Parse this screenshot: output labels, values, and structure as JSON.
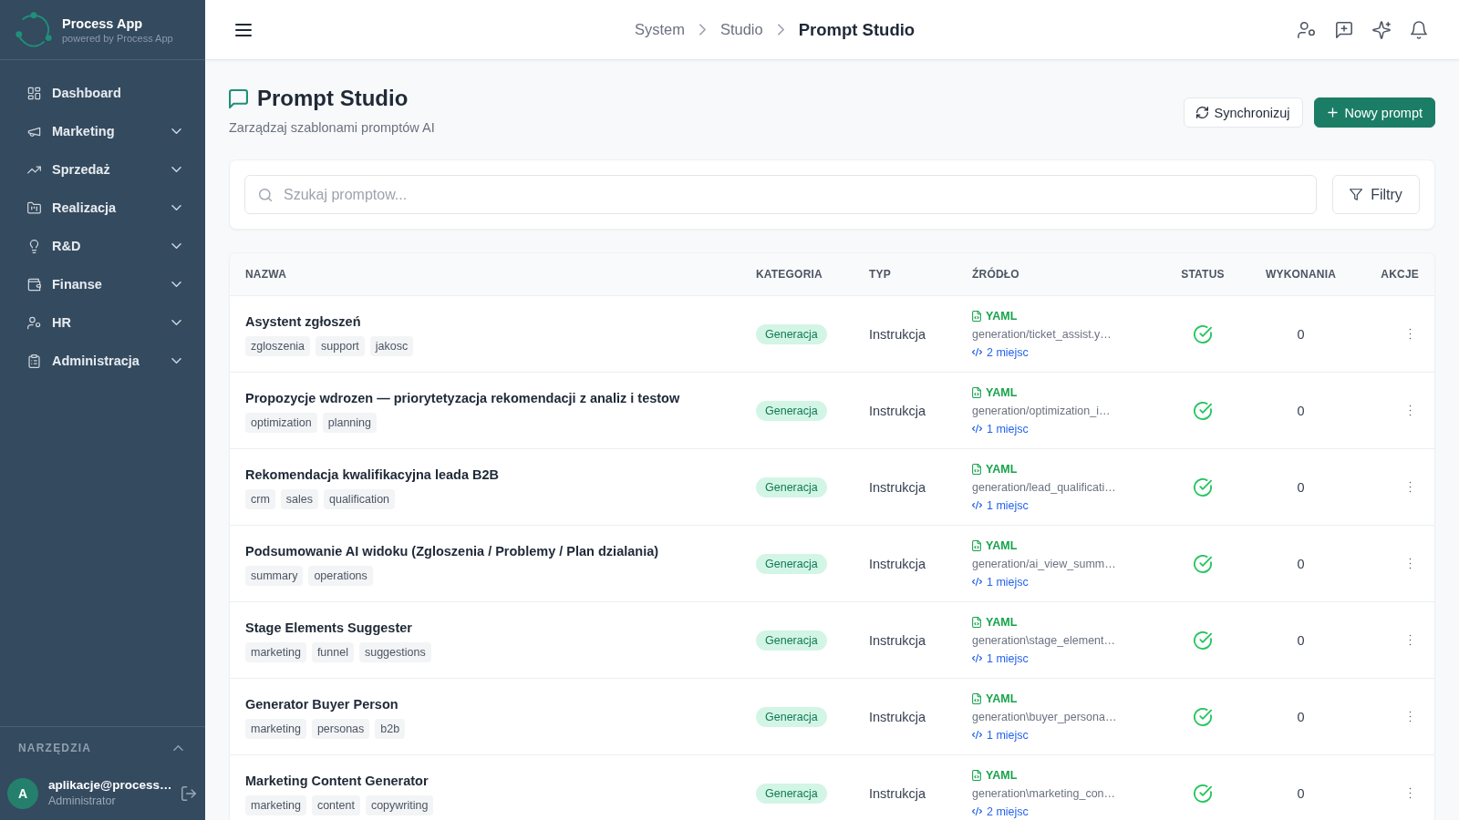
{
  "sidebar": {
    "brand": {
      "name": "Process App",
      "tagline": "powered by Process App"
    },
    "items": [
      {
        "label": "Dashboard",
        "kind": "link"
      },
      {
        "label": "Marketing",
        "kind": "group",
        "expanded": false
      },
      {
        "label": "Sprzedaż",
        "kind": "group",
        "expanded": false
      },
      {
        "label": "Realizacja",
        "kind": "group",
        "expanded": false
      },
      {
        "label": "R&D",
        "kind": "group",
        "expanded": false
      },
      {
        "label": "Finanse",
        "kind": "group",
        "expanded": false
      },
      {
        "label": "HR",
        "kind": "group",
        "expanded": false
      },
      {
        "label": "Administracja",
        "kind": "group",
        "expanded": false
      }
    ],
    "tools_section": {
      "label": "NARZĘDZIA",
      "expanded": true
    },
    "user": {
      "initial": "A",
      "email": "aplikacje@process…",
      "role": "Administrator"
    }
  },
  "header": {
    "breadcrumbs": [
      {
        "label": "System",
        "current": false
      },
      {
        "label": "Studio",
        "current": false
      },
      {
        "label": "Prompt Studio",
        "current": true
      }
    ]
  },
  "page": {
    "title": "Prompt Studio",
    "subtitle": "Zarządzaj szablonami promptów AI",
    "buttons": [
      {
        "label": "Synchronizuj",
        "kind": "secondary"
      },
      {
        "label": "Nowy prompt",
        "kind": "primary"
      }
    ]
  },
  "search": {
    "placeholder": "Szukaj promptow...",
    "filter_button": "Filtry"
  },
  "table": {
    "columns": [
      "NAZWA",
      "KATEGORIA",
      "TYP",
      "ŹRÓDŁO",
      "STATUS",
      "WYKONANIA",
      "AKCJE"
    ],
    "rows": [
      {
        "name": "Asystent zgłoszeń",
        "tags": [
          "zgloszenia",
          "support",
          "jakosc"
        ],
        "category": "Generacja",
        "type": "Instrukcja",
        "source_format": "YAML",
        "source_path": "generation/ticket_assist.y…",
        "usages": "2 miejsc",
        "active": true,
        "runs": "0"
      },
      {
        "name": "Propozycje wdrozen — priorytetyzacja rekomendacji z analiz i testow",
        "tags": [
          "optimization",
          "planning"
        ],
        "category": "Generacja",
        "type": "Instrukcja",
        "source_format": "YAML",
        "source_path": "generation/optimization_i…",
        "usages": "1 miejsc",
        "active": true,
        "runs": "0"
      },
      {
        "name": "Rekomendacja kwalifikacyjna leada B2B",
        "tags": [
          "crm",
          "sales",
          "qualification"
        ],
        "category": "Generacja",
        "type": "Instrukcja",
        "source_format": "YAML",
        "source_path": "generation/lead_qualificati…",
        "usages": "1 miejsc",
        "active": true,
        "runs": "0"
      },
      {
        "name": "Podsumowanie AI widoku (Zgloszenia / Problemy / Plan dzialania)",
        "tags": [
          "summary",
          "operations"
        ],
        "category": "Generacja",
        "type": "Instrukcja",
        "source_format": "YAML",
        "source_path": "generation/ai_view_summ…",
        "usages": "1 miejsc",
        "active": true,
        "runs": "0"
      },
      {
        "name": "Stage Elements Suggester",
        "tags": [
          "marketing",
          "funnel",
          "suggestions"
        ],
        "category": "Generacja",
        "type": "Instrukcja",
        "source_format": "YAML",
        "source_path": "generation\\stage_element…",
        "usages": "1 miejsc",
        "active": true,
        "runs": "0"
      },
      {
        "name": "Generator Buyer Person",
        "tags": [
          "marketing",
          "personas",
          "b2b"
        ],
        "category": "Generacja",
        "type": "Instrukcja",
        "source_format": "YAML",
        "source_path": "generation\\buyer_persona…",
        "usages": "1 miejsc",
        "active": true,
        "runs": "0"
      },
      {
        "name": "Marketing Content Generator",
        "tags": [
          "marketing",
          "content",
          "copywriting"
        ],
        "category": "Generacja",
        "type": "Instrukcja",
        "source_format": "YAML",
        "source_path": "generation\\marketing_con…",
        "usages": "2 miejsc",
        "active": true,
        "runs": "0"
      }
    ]
  }
}
